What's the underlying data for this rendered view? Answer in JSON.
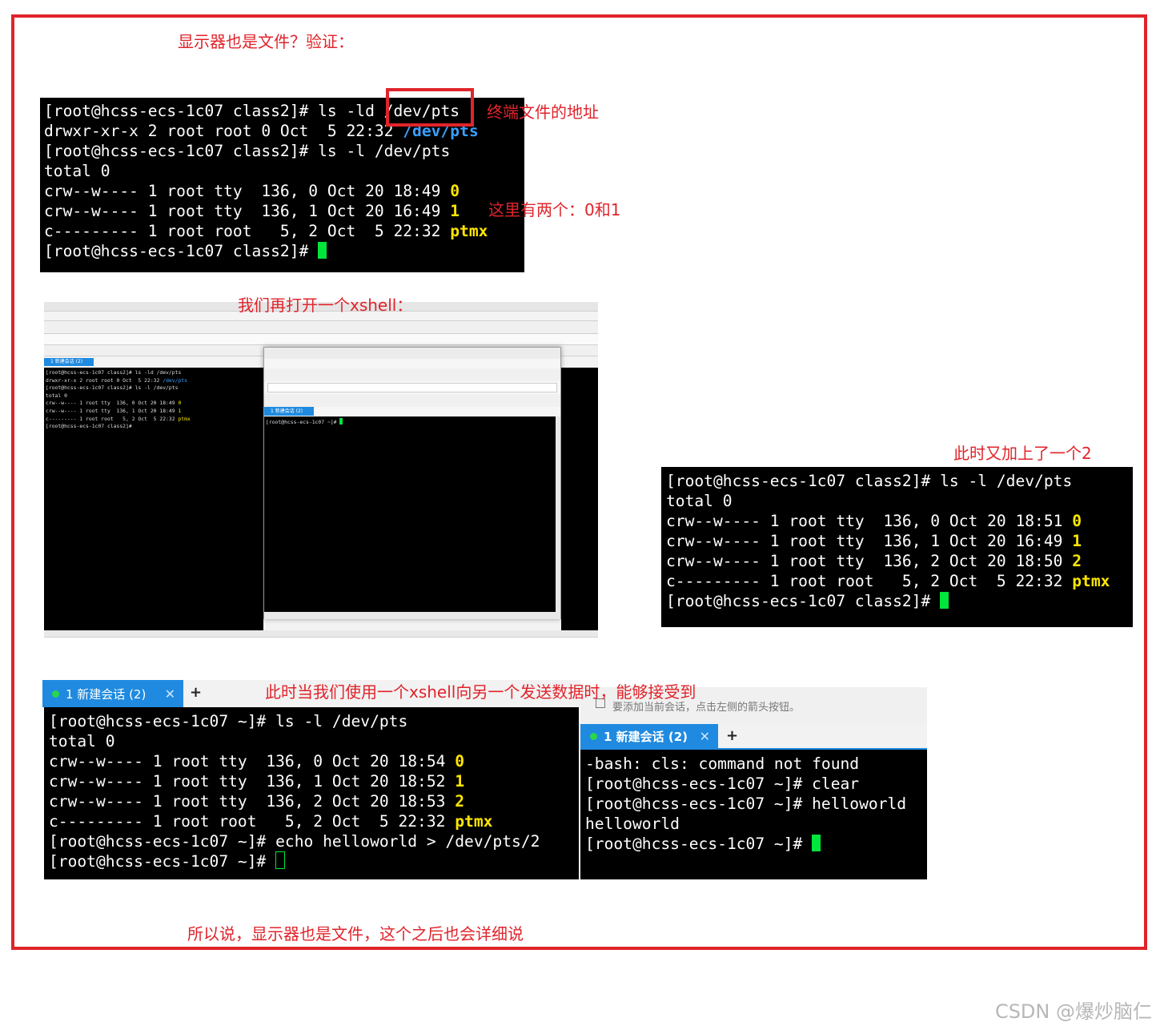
{
  "annotations": {
    "title": "显示器也是文件？验证：",
    "terminal_addr": "终端文件的地址",
    "two_entries": "这里有两个：0和1",
    "open_xshell": "我们再打开一个xshell：",
    "added_two": "此时又加上了一个2",
    "send_data": "此时当我们使用一个xshell向另一个发送数据时，能够接受到",
    "conclusion": "所以说，显示器也是文件，这个之后也会详细说"
  },
  "term1": {
    "l1": "[root@hcss-ecs-1c07 class2]# ls -ld /dev/pts",
    "l2a": "drwxr-xr-x 2 root root 0 Oct  5 22:32 ",
    "l2b": "/dev/pts",
    "l3": "[root@hcss-ecs-1c07 class2]# ls -l /dev/pts",
    "l4": "total 0",
    "l5a": "crw--w---- 1 root tty  136, 0 Oct 20 18:49 ",
    "l5b": "0",
    "l6a": "crw--w---- 1 root tty  136, 1 Oct 20 16:49 ",
    "l6b": "1",
    "l7a": "c--------- 1 root root   5, 2 Oct  5 22:32 ",
    "l7b": "ptmx",
    "l8": "[root@hcss-ecs-1c07 class2]# "
  },
  "term2": {
    "l1": "[root@hcss-ecs-1c07 class2]# ls -l /dev/pts",
    "l2": "total 0",
    "l3a": "crw--w---- 1 root tty  136, 0 Oct 20 18:51 ",
    "l3b": "0",
    "l4a": "crw--w---- 1 root tty  136, 1 Oct 20 16:49 ",
    "l4b": "1",
    "l5a": "crw--w---- 1 root tty  136, 2 Oct 20 18:50 ",
    "l5b": "2",
    "l6a": "c--------- 1 root root   5, 2 Oct  5 22:32 ",
    "l6b": "ptmx",
    "l7": "[root@hcss-ecs-1c07 class2]# "
  },
  "tab_left": {
    "label": "1 新建会话 (2)",
    "close": "✕",
    "add": "+"
  },
  "tab_right": {
    "label": "1 新建会话 (2)",
    "close": "✕",
    "add": "+",
    "hint": "要添加当前会话，点击左侧的箭头按钮。"
  },
  "term3": {
    "l1": "[root@hcss-ecs-1c07 ~]# ls -l /dev/pts",
    "l2": "total 0",
    "l3a": "crw--w---- 1 root tty  136, 0 Oct 20 18:54 ",
    "l3b": "0",
    "l4a": "crw--w---- 1 root tty  136, 1 Oct 20 18:52 ",
    "l4b": "1",
    "l5a": "crw--w---- 1 root tty  136, 2 Oct 20 18:53 ",
    "l5b": "2",
    "l6a": "c--------- 1 root root   5, 2 Oct  5 22:32 ",
    "l6b": "ptmx",
    "l7": "[root@hcss-ecs-1c07 ~]# echo helloworld > /dev/pts/2",
    "l8": "[root@hcss-ecs-1c07 ~]# "
  },
  "term4": {
    "l1": "-bash: cls: command not found",
    "l2": "[root@hcss-ecs-1c07 ~]# clear",
    "l3": "[root@hcss-ecs-1c07 ~]# helloworld",
    "l4": "helloworld",
    "l5": "[root@hcss-ecs-1c07 ~]# "
  },
  "xshell_shot": {
    "mini_left": {
      "l1": "[root@hcss-ecs-1c07 class2]# ls -ld /dev/pts",
      "l2a": "drwxr-xr-x 2 root root 0 Oct  5 22:32 ",
      "l2b": "/dev/pts",
      "l3": "[root@hcss-ecs-1c07 class2]# ls -l /dev/pts",
      "l4": "total 0",
      "l5a": "crw--w---- 1 root tty  136, 0 Oct 20 18:49 ",
      "l5b": "0",
      "l6a": "crw--w---- 1 root tty  136, 1 Oct 20 18:49 ",
      "l6b": "1",
      "l7a": "c--------- 1 root root   5, 2 Oct  5 22:32 ",
      "l7b": "ptmx",
      "l8": "[root@hcss-ecs-1c07 class2]# "
    },
    "mini_right": {
      "l1": "[root@hcss-ecs-1c07 ~]# "
    },
    "tab_left": "1 新建会话 (2)",
    "tab_right": "1 新建会话 (2)"
  },
  "watermark": "CSDN @爆炒脑仁"
}
